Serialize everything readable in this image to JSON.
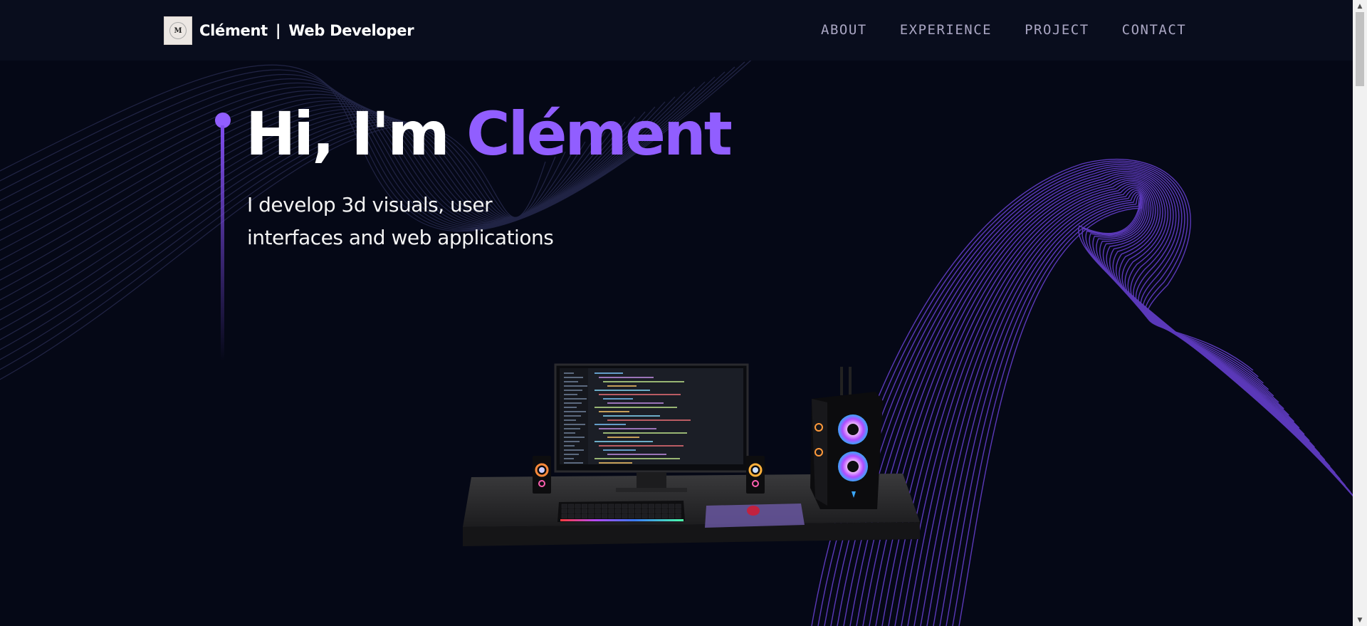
{
  "brand": {
    "logo_letter": "M",
    "name": "Clément",
    "separator": "|",
    "role": "Web Developer"
  },
  "nav": {
    "items": [
      {
        "label": "ABOUT"
      },
      {
        "label": "EXPERIENCE"
      },
      {
        "label": "PROJECT"
      },
      {
        "label": "CONTACT"
      }
    ]
  },
  "hero": {
    "greeting": "Hi, I'm ",
    "name": "Clément",
    "subtitle_line1": "I develop 3d visuals, user",
    "subtitle_line2": "interfaces and web applications"
  },
  "colors": {
    "background": "#050816",
    "navbar": "#090d1d",
    "accent": "#915eff",
    "nav_text": "#aaa6c3",
    "text": "#ffffff"
  },
  "icons": {
    "scroll_up": "triangle-up-icon",
    "scroll_down": "triangle-down-icon"
  }
}
